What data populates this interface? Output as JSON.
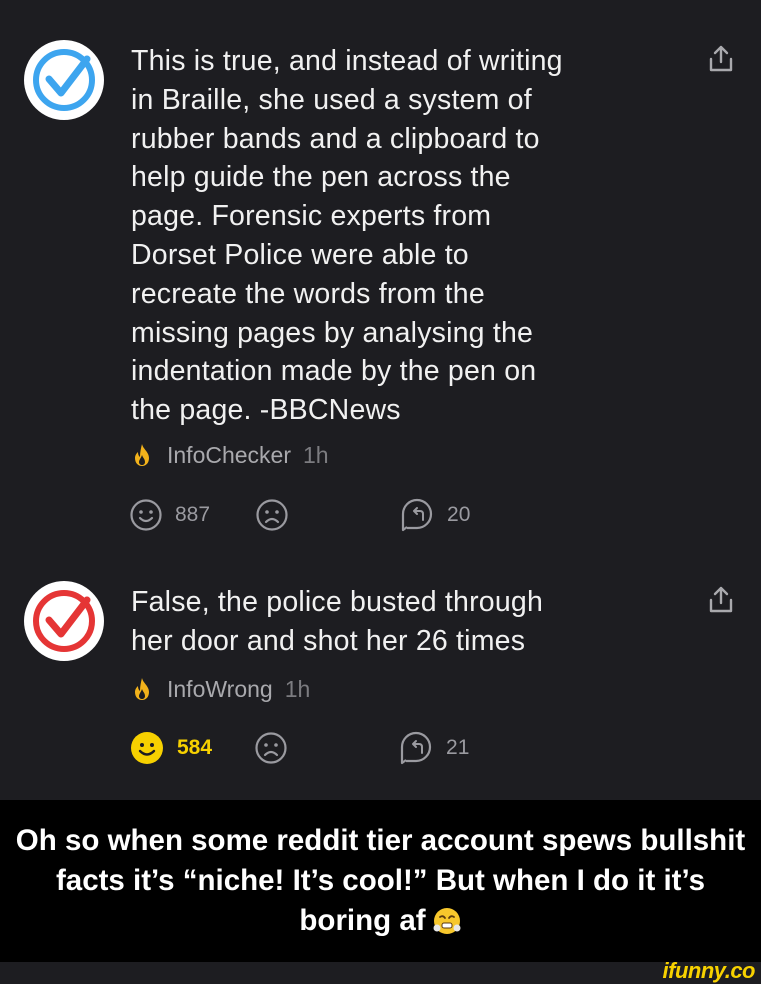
{
  "comments": [
    {
      "avatar_icon": "blue-check-icon",
      "accent": "#3da5ef",
      "text": "This is true, and instead of writing\nin Braille, she used a system of\nrubber bands and a clipboard to\nhelp guide the pen across the\npage. Forensic experts from\nDorset Police were able to\nrecreate the words from the\nmissing pages by analysing the\nindentation made by the pen on\nthe page. -BBCNews",
      "username": "InfoChecker",
      "time": "1h",
      "smile_count": "887",
      "reply_count": "20",
      "smile_active": false
    },
    {
      "avatar_icon": "red-check-icon",
      "accent": "#e53535",
      "text": "False, the police busted through\nher door and shot her 26 times",
      "username": "InfoWrong",
      "time": "1h",
      "smile_count": "584",
      "reply_count": "21",
      "smile_active": true
    }
  ],
  "caption": "Oh so when some reddit tier account spews bullshit facts it’s “niche! It’s cool!” But when I do it it’s boring af",
  "watermark": "ifunny.co",
  "colors": {
    "background": "#1d1d21",
    "flame": "#f2b21b",
    "smile_active": "#f7d100",
    "watermark": "#f7d100"
  }
}
